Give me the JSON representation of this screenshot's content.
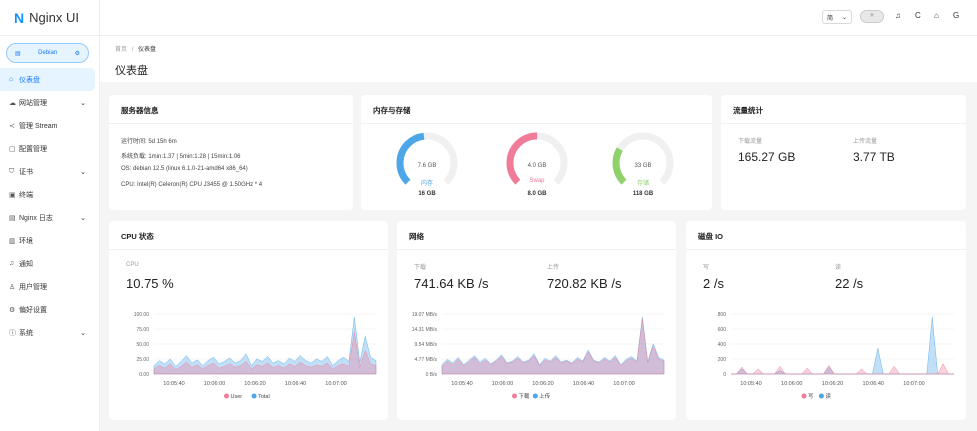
{
  "app": {
    "logo_letter": "N",
    "title": "Nginx UI"
  },
  "node": {
    "name": "Debian"
  },
  "menu": [
    {
      "icon": "⌂",
      "label": "仪表盘",
      "active": true,
      "chev": ""
    },
    {
      "icon": "☁",
      "label": "网站管理",
      "chev": "⌄"
    },
    {
      "icon": "≺",
      "label": "管理 Stream",
      "chev": ""
    },
    {
      "icon": "▢",
      "label": "配置管理",
      "chev": ""
    },
    {
      "icon": "⛉",
      "label": "证书",
      "chev": "⌄"
    },
    {
      "icon": "▣",
      "label": "终端",
      "chev": ""
    },
    {
      "icon": "▤",
      "label": "Nginx 日志",
      "chev": "⌄"
    },
    {
      "icon": "▥",
      "label": "环境",
      "chev": ""
    },
    {
      "icon": "♫",
      "label": "通知",
      "chev": ""
    },
    {
      "icon": "♙",
      "label": "用户管理",
      "chev": ""
    },
    {
      "icon": "⚙",
      "label": "偏好设置",
      "chev": ""
    },
    {
      "icon": "ⓘ",
      "label": "系统",
      "chev": "⌄"
    }
  ],
  "topbar": {
    "lang": "简",
    "lang_arrow": "⌄",
    "theme": "☀",
    "icons": [
      "♫",
      "C",
      "⌂",
      "G"
    ]
  },
  "breadcrumb": {
    "home": "首页",
    "sep": "/",
    "current": "仪表盘"
  },
  "page_title": "仪表盘",
  "server_info": {
    "title": "服务器信息",
    "uptime": "运行时间: 5d 15h 6m",
    "load": "系统负载: 1min:1.37 | 5min:1.28 | 15min:1.06",
    "os": "OS: debian 12.5 (linux 6.1.0-21-amd64 x86_64)",
    "cpu": "CPU: Intel(R) Celeron(R) CPU J3455 @ 1.50GHz * 4"
  },
  "mem": {
    "title": "内存与存储",
    "gauges": [
      {
        "value": "7.6 GB",
        "label": "内存",
        "total": "16 GB",
        "pct": 0.475,
        "color": "#4da6e8"
      },
      {
        "value": "4.0 GB",
        "label": "Swap",
        "total": "8.0 GB",
        "pct": 0.5,
        "color": "#f07c9a"
      },
      {
        "value": "33 GB",
        "label": "存储",
        "total": "118 GB",
        "pct": 0.28,
        "color": "#8fd16b"
      }
    ]
  },
  "traffic": {
    "title": "流量统计",
    "down_label": "下载流量",
    "down_value": "165.27 GB",
    "up_label": "上传流量",
    "up_value": "3.77 TB"
  },
  "cpu": {
    "title": "CPU 状态",
    "label": "CPU",
    "value": "10.75 %"
  },
  "net": {
    "title": "网络",
    "down_label": "下载",
    "down_value": "741.64 KB /s",
    "up_label": "上传",
    "up_value": "720.82 KB /s"
  },
  "disk": {
    "title": "磁盘 IO",
    "write_label": "写",
    "write_value": "2 /s",
    "read_label": "读",
    "read_value": "22 /s"
  },
  "colors": {
    "accent": "#1677ff",
    "pink": "#f07c9a",
    "blue": "#4da6e8",
    "green": "#8fd16b"
  },
  "chart_data": [
    {
      "type": "area",
      "ylabels": [
        "100.00",
        "75.00",
        "50.00",
        "25.00",
        "0.00"
      ],
      "x": [
        "10:05:40",
        "10:06:00",
        "10:06:20",
        "10:06:40",
        "10:07:00"
      ],
      "series": [
        {
          "name": "User",
          "color": "#f07c9a",
          "values": [
            6,
            10,
            7,
            12,
            5,
            9,
            14,
            8,
            11,
            6,
            10,
            13,
            7,
            9,
            12,
            8,
            10,
            15,
            6,
            11,
            9,
            13,
            8,
            10,
            7,
            12,
            9,
            14,
            10,
            8,
            11,
            9,
            13,
            6,
            10,
            12,
            9,
            50,
            8,
            28,
            12,
            10
          ]
        },
        {
          "name": "Total",
          "color": "#4da6e8",
          "values": [
            10,
            16,
            12,
            18,
            9,
            15,
            22,
            13,
            17,
            10,
            16,
            20,
            12,
            15,
            19,
            13,
            16,
            24,
            10,
            18,
            15,
            21,
            13,
            16,
            12,
            19,
            15,
            22,
            16,
            13,
            18,
            15,
            21,
            10,
            16,
            20,
            15,
            68,
            14,
            45,
            20,
            16
          ]
        }
      ]
    },
    {
      "type": "area",
      "ylabels": [
        "19.07 MB/s",
        "14.31 MB/s",
        "9.54 MB/s",
        "4.77 MB/s",
        "0 B/s"
      ],
      "x": [
        "10:05:40",
        "10:06:00",
        "10:06:20",
        "10:06:40",
        "10:07:00"
      ],
      "series": [
        {
          "name": "下载",
          "color": "#f07c9a",
          "values": [
            8,
            14,
            10,
            16,
            9,
            13,
            18,
            11,
            15,
            10,
            14,
            19,
            11,
            13,
            17,
            12,
            14,
            20,
            9,
            15,
            13,
            18,
            12,
            14,
            11,
            16,
            13,
            24,
            14,
            12,
            16,
            13,
            18,
            9,
            14,
            17,
            13,
            60,
            12,
            30,
            16,
            14
          ]
        },
        {
          "name": "上传",
          "color": "#4da6e8",
          "values": [
            10,
            16,
            12,
            18,
            10,
            15,
            20,
            13,
            17,
            11,
            15,
            21,
            12,
            14,
            19,
            13,
            15,
            22,
            10,
            17,
            14,
            20,
            13,
            15,
            12,
            18,
            14,
            26,
            15,
            13,
            18,
            14,
            20,
            10,
            16,
            19,
            14,
            62,
            13,
            33,
            18,
            15
          ]
        }
      ]
    },
    {
      "type": "area",
      "ylabels": [
        "800",
        "600",
        "400",
        "200",
        "0"
      ],
      "x": [
        "10:05:40",
        "10:06:00",
        "10:06:20",
        "10:06:40",
        "10:07:00"
      ],
      "series": [
        {
          "name": "写",
          "color": "#f07c9a",
          "values": [
            0,
            0,
            80,
            0,
            0,
            60,
            0,
            0,
            0,
            90,
            0,
            0,
            0,
            0,
            70,
            0,
            0,
            0,
            100,
            0,
            0,
            0,
            0,
            0,
            60,
            0,
            0,
            0,
            0,
            0,
            90,
            0,
            0,
            0,
            0,
            0,
            0,
            0,
            0,
            120,
            0,
            0
          ]
        },
        {
          "name": "读",
          "color": "#4da6e8",
          "values": [
            0,
            0,
            60,
            0,
            0,
            0,
            0,
            0,
            0,
            40,
            0,
            0,
            0,
            0,
            0,
            0,
            0,
            0,
            80,
            0,
            0,
            0,
            0,
            0,
            0,
            0,
            0,
            300,
            0,
            0,
            0,
            0,
            0,
            0,
            0,
            0,
            0,
            660,
            0,
            0,
            0,
            0
          ]
        }
      ]
    }
  ]
}
